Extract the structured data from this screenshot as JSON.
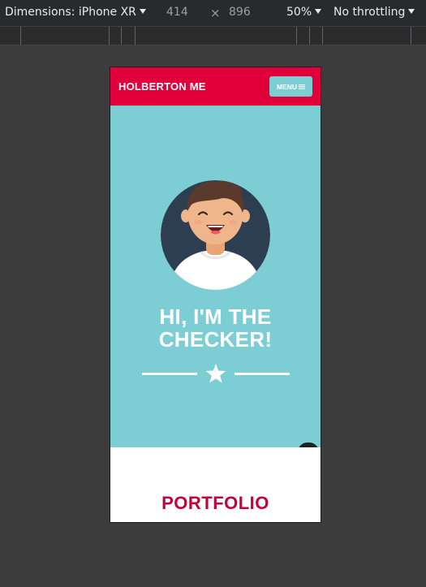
{
  "devtools": {
    "device_label": "Dimensions: iPhone XR",
    "width": "414",
    "times": "×",
    "height": "896",
    "zoom": "50%",
    "throttling": "No throttling"
  },
  "site": {
    "brand": "HOLBERTON ME",
    "menu_label": "MENU",
    "hero_title_line1": "HI, I'M THE",
    "hero_title_line2": "CHECKER!",
    "portfolio_title": "PORTFOLIO"
  },
  "colors": {
    "header": "#e1003a",
    "hero": "#7ccdd4",
    "accent_text": "#c70039"
  },
  "icons": {
    "divider": "star-icon",
    "menu": "hamburger-icon",
    "float_1": "translate-icon",
    "float_2": "chat-bot-icon"
  }
}
